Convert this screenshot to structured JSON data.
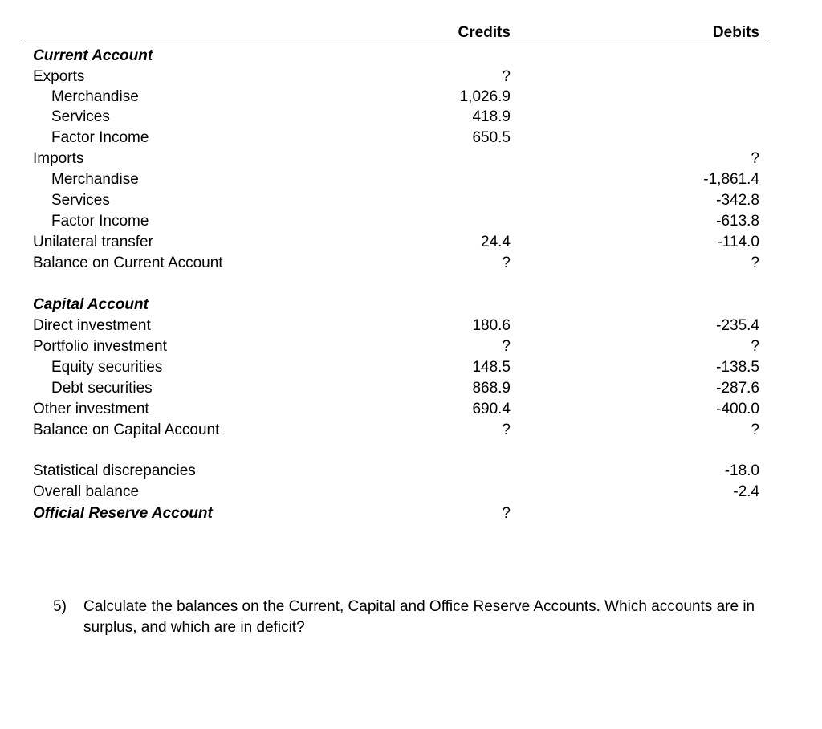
{
  "header": {
    "credits": "Credits",
    "debits": "Debits"
  },
  "rows": [
    {
      "label": "Current Account",
      "style": "section",
      "credit": "",
      "debit": ""
    },
    {
      "label": "Exports",
      "style": "normal",
      "credit": "?",
      "debit": ""
    },
    {
      "label": "Merchandise",
      "style": "indent",
      "credit": "1,026.9",
      "debit": ""
    },
    {
      "label": "Services",
      "style": "indent",
      "credit": "418.9",
      "debit": ""
    },
    {
      "label": "Factor Income",
      "style": "indent",
      "credit": "650.5",
      "debit": ""
    },
    {
      "label": "Imports",
      "style": "normal",
      "credit": "",
      "debit": "?"
    },
    {
      "label": "Merchandise",
      "style": "indent",
      "credit": "",
      "debit": "-1,861.4"
    },
    {
      "label": "Services",
      "style": "indent",
      "credit": "",
      "debit": "-342.8"
    },
    {
      "label": "Factor Income",
      "style": "indent",
      "credit": "",
      "debit": "-613.8"
    },
    {
      "label": "Unilateral transfer",
      "style": "normal",
      "credit": "24.4",
      "debit": "-114.0"
    },
    {
      "label": "Balance on Current Account",
      "style": "normal",
      "credit": "?",
      "debit": "?"
    },
    {
      "label": "Capital Account",
      "style": "section",
      "credit": "",
      "debit": ""
    },
    {
      "label": "Direct investment",
      "style": "normal",
      "credit": "180.6",
      "debit": "-235.4"
    },
    {
      "label": "Portfolio investment",
      "style": "normal",
      "credit": "?",
      "debit": "?"
    },
    {
      "label": "Equity securities",
      "style": "indent",
      "credit": "148.5",
      "debit": "-138.5"
    },
    {
      "label": "Debt securities",
      "style": "indent",
      "credit": "868.9",
      "debit": "-287.6"
    },
    {
      "label": "Other investment",
      "style": "normal",
      "credit": "690.4",
      "debit": "-400.0"
    },
    {
      "label": "Balance on Capital Account",
      "style": "normal",
      "credit": "?",
      "debit": "?"
    },
    {
      "label": "Statistical discrepancies",
      "style": "normal",
      "credit": "",
      "debit": "-18.0"
    },
    {
      "label": "Overall balance",
      "style": "normal",
      "credit": "",
      "debit": "-2.4"
    },
    {
      "label": "Official Reserve Account",
      "style": "section",
      "credit": "?",
      "debit": ""
    }
  ],
  "question": {
    "number": "5)",
    "text": "Calculate the balances on the Current, Capital and Office Reserve Accounts. Which accounts are in surplus, and which are in deficit?"
  }
}
